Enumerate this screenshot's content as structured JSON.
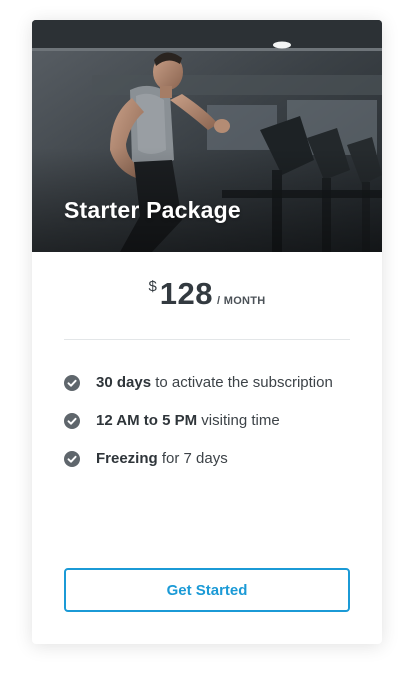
{
  "card": {
    "image": {
      "subject": "man running on treadmill in gym"
    },
    "title": "Starter Package",
    "price": {
      "currency": "$",
      "amount": "128",
      "period": "/ MONTH"
    },
    "features": [
      {
        "icon": "check-circle-icon",
        "bold": "30 days",
        "rest": " to activate the subscription"
      },
      {
        "icon": "check-circle-icon",
        "bold": "12 AM to 5 PM",
        "rest": " visiting time"
      },
      {
        "icon": "check-circle-icon",
        "bold": "Freezing",
        "rest": " for 7 days"
      }
    ],
    "cta_label": "Get Started"
  },
  "colors": {
    "accent": "#1b9ad6",
    "text": "#333a40",
    "check": "#5f666c"
  }
}
